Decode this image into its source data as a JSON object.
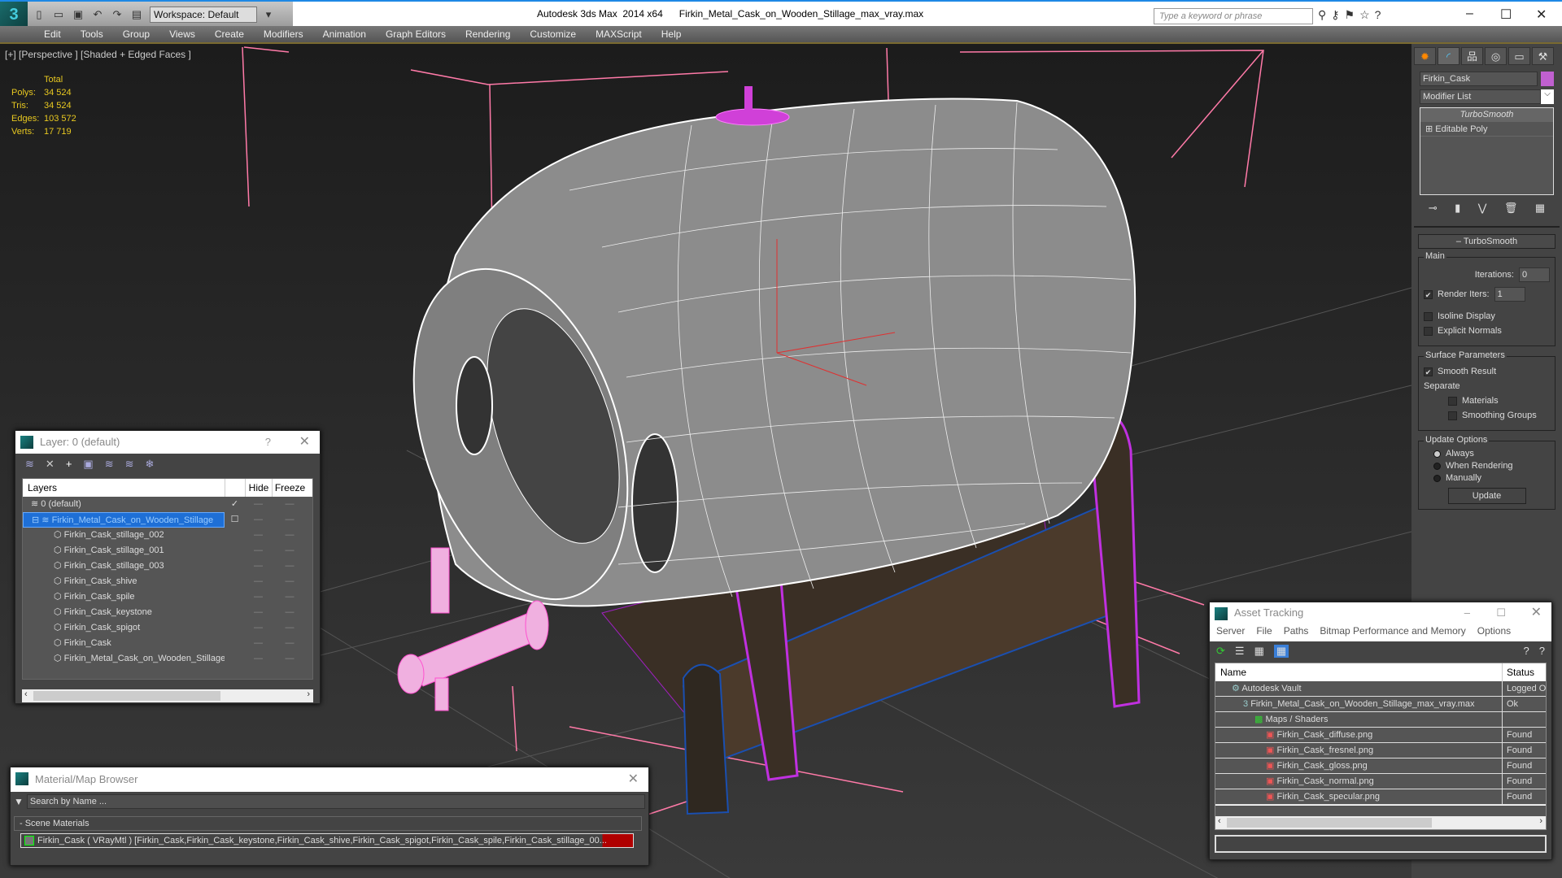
{
  "app": {
    "title": "Autodesk 3ds Max  2014 x64",
    "file": "Firkin_Metal_Cask_on_Wooden_Stillage_max_vray.max",
    "workspace": "Workspace: Default",
    "search_placeholder": "Type a keyword or phrase"
  },
  "menu": [
    "Edit",
    "Tools",
    "Group",
    "Views",
    "Create",
    "Modifiers",
    "Animation",
    "Graph Editors",
    "Rendering",
    "Customize",
    "MAXScript",
    "Help"
  ],
  "viewport": {
    "label": "[+] [Perspective ] [Shaded + Edged Faces ]",
    "stats": {
      "header": "Total",
      "rows": [
        {
          "k": "Polys:",
          "v": "34 524"
        },
        {
          "k": "Tris:",
          "v": "34 524"
        },
        {
          "k": "Edges:",
          "v": "103 572"
        },
        {
          "k": "Verts:",
          "v": "17 719"
        }
      ]
    }
  },
  "command_panel": {
    "object_name": "Firkin_Cask",
    "object_color": "#c060d0",
    "modifier_list": "Modifier List",
    "stack": [
      "TurboSmooth",
      "Editable Poly"
    ],
    "rollout": "TurboSmooth",
    "main": "Main",
    "iterations_label": "Iterations:",
    "iterations": "0",
    "render_iters_label": "Render Iters:",
    "render_iters": "1",
    "render_iters_checked": true,
    "isoline": "Isoline Display",
    "explicit_normals": "Explicit Normals",
    "surface": "Surface Parameters",
    "smooth_result": "Smooth Result",
    "separate": "Separate",
    "materials": "Materials",
    "smoothing_groups": "Smoothing Groups",
    "update_options": "Update Options",
    "always": "Always",
    "when_rendering": "When Rendering",
    "manually": "Manually",
    "update": "Update",
    "selected_update": "Always"
  },
  "layer_dialog": {
    "title": "Layer: 0 (default)",
    "help": "?",
    "cols": {
      "layers": "Layers",
      "hide": "Hide",
      "freeze": "Freeze"
    },
    "rows": [
      {
        "name": "0 (default)",
        "level": 0,
        "type": "layer",
        "current": true
      },
      {
        "name": "Firkin_Metal_Cask_on_Wooden_Stillage",
        "level": 0,
        "type": "layer",
        "selected": true
      },
      {
        "name": "Firkin_Cask_stillage_002",
        "level": 1
      },
      {
        "name": "Firkin_Cask_stillage_001",
        "level": 1
      },
      {
        "name": "Firkin_Cask_stillage_003",
        "level": 1
      },
      {
        "name": "Firkin_Cask_shive",
        "level": 1
      },
      {
        "name": "Firkin_Cask_spile",
        "level": 1
      },
      {
        "name": "Firkin_Cask_keystone",
        "level": 1
      },
      {
        "name": "Firkin_Cask_spigot",
        "level": 1
      },
      {
        "name": "Firkin_Cask",
        "level": 1
      },
      {
        "name": "Firkin_Metal_Cask_on_Wooden_Stillage",
        "level": 1
      }
    ]
  },
  "material_browser": {
    "title": "Material/Map Browser",
    "search_placeholder": "Search by Name ...",
    "section": "- Scene Materials",
    "item": "Firkin_Cask ( VRayMtl ) [Firkin_Cask,Firkin_Cask_keystone,Firkin_Cask_shive,Firkin_Cask_spigot,Firkin_Cask_spile,Firkin_Cask_stillage_00..."
  },
  "asset_tracking": {
    "title": "Asset Tracking",
    "menu": [
      "Server",
      "File",
      "Paths",
      "Bitmap Performance and Memory",
      "Options"
    ],
    "cols": {
      "name": "Name",
      "status": "Status"
    },
    "rows": [
      {
        "name": "Autodesk Vault",
        "status": "Logged Out",
        "level": 0,
        "icon": "vault"
      },
      {
        "name": "Firkin_Metal_Cask_on_Wooden_Stillage_max_vray.max",
        "status": "Ok",
        "level": 1,
        "icon": "max"
      },
      {
        "name": "Maps / Shaders",
        "status": "",
        "level": 2,
        "icon": "maps"
      },
      {
        "name": "Firkin_Cask_diffuse.png",
        "status": "Found",
        "level": 3,
        "icon": "png"
      },
      {
        "name": "Firkin_Cask_fresnel.png",
        "status": "Found",
        "level": 3,
        "icon": "png"
      },
      {
        "name": "Firkin_Cask_gloss.png",
        "status": "Found",
        "level": 3,
        "icon": "png"
      },
      {
        "name": "Firkin_Cask_normal.png",
        "status": "Found",
        "level": 3,
        "icon": "png"
      },
      {
        "name": "Firkin_Cask_specular.png",
        "status": "Found",
        "level": 3,
        "icon": "png"
      }
    ]
  }
}
